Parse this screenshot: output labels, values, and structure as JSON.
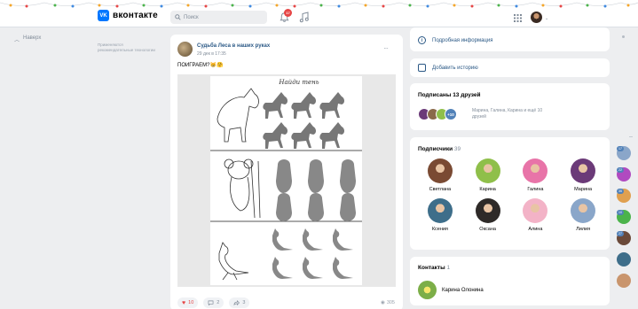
{
  "header": {
    "logo_mark": "VK",
    "logo_text": "вконтакте",
    "search_placeholder": "Поиск",
    "notifications_count": "17"
  },
  "left": {
    "back_to_top": "Наверх",
    "ad_note": "Применяются рекомендательные технологии"
  },
  "post": {
    "author": "Судьба Леса в наших руках",
    "date": "29 дек в 17:35",
    "more": "···",
    "text": "ПОИГРАЕМ?😸🤗",
    "image_caption": "Найди тень",
    "likes": "10",
    "comments": "2",
    "shares": "3",
    "views": "305"
  },
  "sidebar": {
    "info_link": "Подробная информация",
    "add_story": "Добавить историю",
    "friends": {
      "title": "Подписаны 13 друзей",
      "more_badge": "+10",
      "names": "Марина, Галина, Карина и ещё 10 друзей"
    },
    "subscribers": {
      "title": "Подписчики",
      "count": "39",
      "people": [
        {
          "name": "Светлана",
          "color": "#7a4a33"
        },
        {
          "name": "Карина",
          "color": "#8fbf4a"
        },
        {
          "name": "Галина",
          "color": "#e874a8"
        },
        {
          "name": "Марина",
          "color": "#6b3a78"
        },
        {
          "name": "Ксения",
          "color": "#3e6e8a"
        },
        {
          "name": "Оксана",
          "color": "#2e2a28"
        },
        {
          "name": "Алина",
          "color": "#f3b3c7"
        },
        {
          "name": "Лилия",
          "color": "#8aa6c9"
        }
      ]
    },
    "contacts": {
      "title": "Контакты",
      "count": "1",
      "name": "Карина Олонина"
    }
  },
  "pins": {
    "badges": [
      "17",
      "22",
      "35",
      "10",
      "27"
    ]
  },
  "colors": {
    "accent": "#0077ff",
    "link": "#2a5885",
    "background": "#edeef0",
    "like_red": "#e64646"
  },
  "icons": [
    "vk-logo",
    "search-icon",
    "bell-icon",
    "music-icon",
    "apps-grid-icon",
    "info-icon",
    "story-icon",
    "heart-icon",
    "comment-icon",
    "share-icon",
    "eye-icon"
  ]
}
